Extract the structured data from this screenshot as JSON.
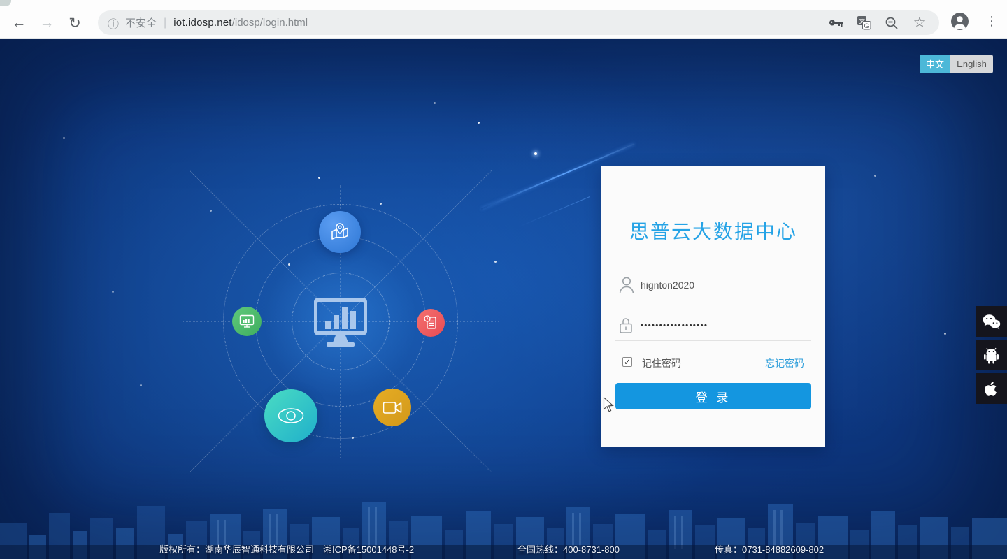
{
  "icons": {
    "back": "←",
    "forward": "→",
    "reload": "↻",
    "info": "ⓘ",
    "star": "☆",
    "menu": "⋮",
    "check": "✓",
    "translate_cjk": "文",
    "translate_latin": "G"
  },
  "browser": {
    "security_label": "不安全",
    "separator": "|",
    "url_host": "iot.idosp.net",
    "url_path": "/idosp/login.html"
  },
  "language_toggle": {
    "chinese_label": "中文",
    "english_label": "English"
  },
  "login_card": {
    "title": "思普云大数据中心",
    "username_value": "hignton2020",
    "password_value": "••••••••••••••••••",
    "remember_label": "记住密码",
    "forgot_link": "忘记密码",
    "login_button_label": "登 录"
  },
  "footer": {
    "copyright": "版权所有：湖南华辰智通科技有限公司　湘ICP备15001448号-2",
    "hotline": "全国热线：400-8731-800",
    "fax": "传真：0731-84882609-802"
  },
  "side_apps": [
    "wechat",
    "android",
    "apple"
  ],
  "colors": {
    "accent_blue": "#25a3e6",
    "button_blue": "#1496e0",
    "toggle_active_bg": "#4cb8d8",
    "page_bg_deep": "#0b2d6b",
    "satellite_blue": "#3f87e0",
    "satellite_green": "#4fbc6c",
    "satellite_red": "#ee5a5e",
    "satellite_teal": "#2fc6c4",
    "satellite_amber": "#dba31e"
  }
}
